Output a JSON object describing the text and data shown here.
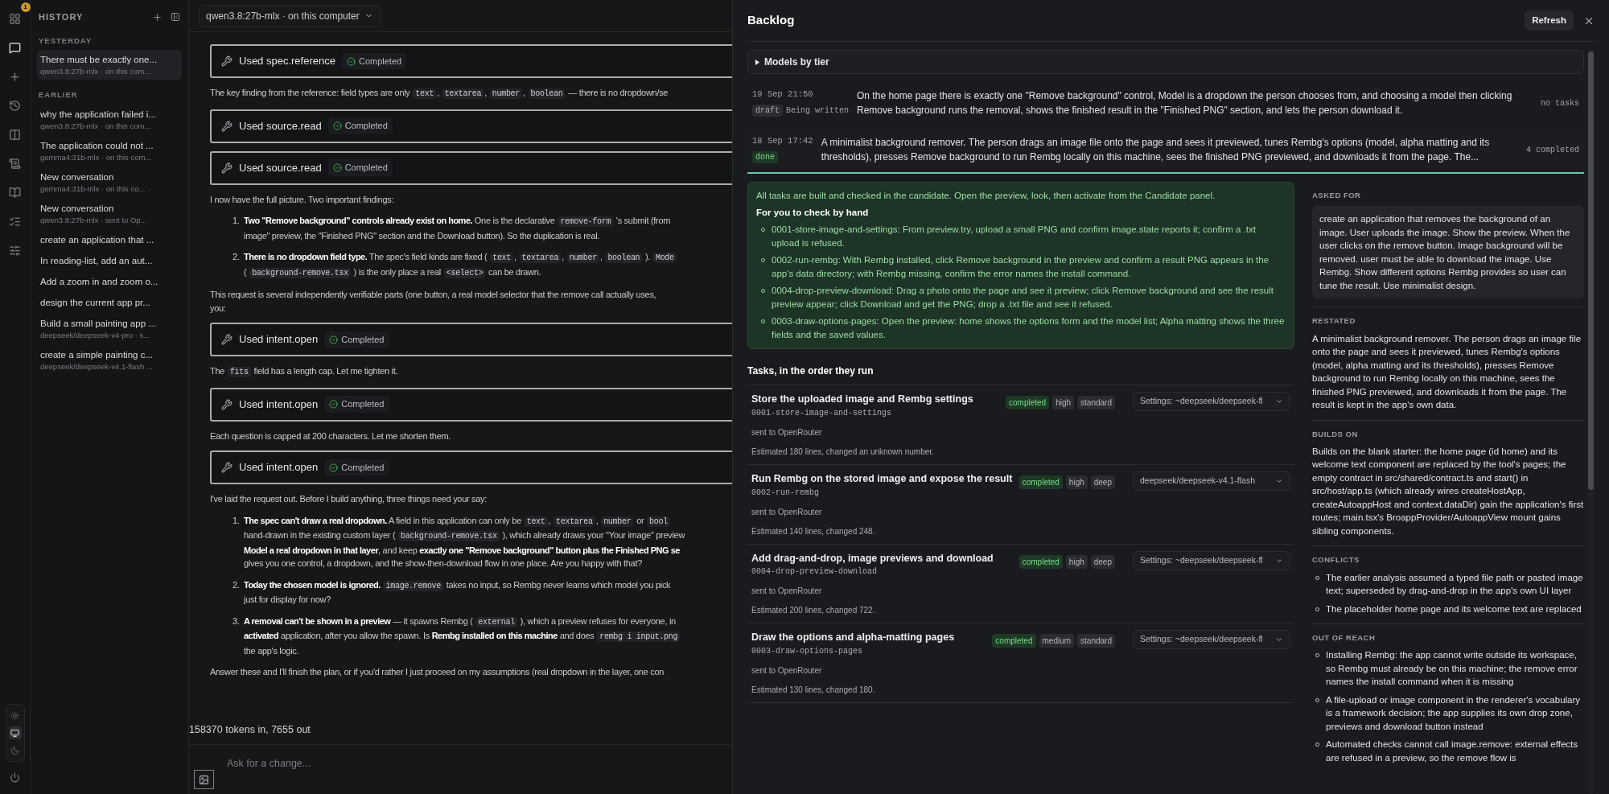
{
  "rail": {
    "items": [
      {
        "kind": "apps",
        "selected": false,
        "badge": "1"
      },
      {
        "kind": "chat",
        "selected": true
      },
      {
        "kind": "new",
        "selected": false
      },
      {
        "kind": "history",
        "selected": false
      },
      {
        "kind": "panel",
        "selected": false
      },
      {
        "kind": "log",
        "selected": false
      },
      {
        "kind": "book",
        "selected": false
      },
      {
        "kind": "tasks",
        "selected": false
      },
      {
        "kind": "settings",
        "selected": false
      }
    ],
    "themes": [
      {
        "kind": "light",
        "selected": false
      },
      {
        "kind": "system",
        "selected": true
      },
      {
        "kind": "dark",
        "selected": false
      }
    ]
  },
  "sidebar": {
    "title": "HISTORY",
    "groups": [
      {
        "label": "YESTERDAY",
        "items": [
          {
            "title": "There must be exactly one...",
            "subtitle": "qwen3.8:27b-mlx · on this com...",
            "selected": true
          }
        ]
      },
      {
        "label": "EARLIER",
        "items": [
          {
            "title": "why the application failed i...",
            "subtitle": "qwen3.8:27b-mlx · on this com...",
            "selected": false
          },
          {
            "title": "The application could not ...",
            "subtitle": "gemma4:31b-mlx · on this com...",
            "selected": false
          },
          {
            "title": "New conversation",
            "subtitle": "gemma4:31b-mlx · on this co...",
            "selected": false
          },
          {
            "title": "New conversation",
            "subtitle": "qwen3.8:27b-mlx · sent to Op...",
            "selected": false
          },
          {
            "title": "create an application that ...",
            "selected": false
          },
          {
            "title": "In reading-list, add an aut...",
            "selected": false
          },
          {
            "title": "Add a zoom in and zoom o...",
            "selected": false
          },
          {
            "title": "design the current app pr...",
            "selected": false
          },
          {
            "title": "Build a small painting app ...",
            "subtitle": "deepseek/deepseek-v4-pro · s...",
            "selected": false
          },
          {
            "title": "create a simple painting c...",
            "subtitle": "deepseek/deepseek-v4.1-flash ...",
            "selected": false
          }
        ]
      }
    ]
  },
  "chat": {
    "model_selector": "qwen3.8:27b-mlx · on this computer",
    "messages": [
      {
        "kind": "tool",
        "name": "Used spec.reference",
        "status": "Completed"
      },
      {
        "kind": "paragraph",
        "lines": [
          [
            {
              "text": "The key finding from the reference: field types are only "
            },
            {
              "code": "text"
            },
            {
              "text": ", "
            },
            {
              "code": "textarea"
            },
            {
              "text": ", "
            },
            {
              "code": "number"
            },
            {
              "text": ", "
            },
            {
              "code": "boolean"
            },
            {
              "text": " — there is no dropdown/se"
            }
          ]
        ]
      },
      {
        "kind": "tool",
        "name": "Used source.read",
        "status": "Completed"
      },
      {
        "kind": "tool",
        "name": "Used source.read",
        "status": "Completed"
      },
      {
        "kind": "paragraph",
        "lines": [
          [
            {
              "text": "I now have the full picture. Two important findings:"
            }
          ]
        ]
      },
      {
        "kind": "list_item",
        "number": "1.",
        "lines": [
          [
            {
              "text": "**Two \"Remove background\" controls already exist on home.** One is the declarative "
            },
            {
              "code": "remove-form"
            },
            {
              "text": " 's submit (from"
            }
          ],
          [
            {
              "text": "image\" preview, the \"Finished PNG\" section and the Download button). So the duplication is real."
            }
          ]
        ]
      },
      {
        "kind": "list_item",
        "number": "2.",
        "lines": [
          [
            {
              "text": "**There is no dropdown field type.** The spec's field kinds are fixed ( "
            },
            {
              "code": "text"
            },
            {
              "text": ", "
            },
            {
              "code": "textarea"
            },
            {
              "text": ", "
            },
            {
              "code": "number"
            },
            {
              "text": ", "
            },
            {
              "code": "boolean"
            },
            {
              "text": " ). "
            },
            {
              "code": "Mode"
            }
          ],
          [
            {
              "text": "( "
            },
            {
              "code": "background-remove.tsx"
            },
            {
              "text": " ) is the only place a real "
            },
            {
              "code": "<select>"
            },
            {
              "text": " can be drawn."
            }
          ]
        ]
      },
      {
        "kind": "paragraph",
        "lines": [
          [
            {
              "text": "This request is several independently verifiable parts (one button, a real model selector that the remove call actually uses,"
            }
          ],
          [
            {
              "text": "you:"
            }
          ]
        ]
      },
      {
        "kind": "tool",
        "name": "Used intent.open",
        "status": "Completed"
      },
      {
        "kind": "paragraph",
        "lines": [
          [
            {
              "text": "The "
            },
            {
              "code": "fits"
            },
            {
              "text": " field has a length cap. Let me tighten it."
            }
          ]
        ]
      },
      {
        "kind": "tool",
        "name": "Used intent.open",
        "status": "Completed"
      },
      {
        "kind": "paragraph",
        "lines": [
          [
            {
              "text": "Each question is capped at 200 characters. Let me shorten them."
            }
          ]
        ]
      },
      {
        "kind": "tool",
        "name": "Used intent.open",
        "status": "Completed"
      },
      {
        "kind": "paragraph",
        "lines": [
          [
            {
              "text": "I've laid the request out. Before I build anything, three things need your say:"
            }
          ]
        ]
      },
      {
        "kind": "list_item",
        "number": "1.",
        "lines": [
          [
            {
              "text": "**The spec can't draw a real dropdown.** A field in this application can only be "
            },
            {
              "code": "text"
            },
            {
              "text": ", "
            },
            {
              "code": "textarea"
            },
            {
              "text": ", "
            },
            {
              "code": "number"
            },
            {
              "text": " or "
            },
            {
              "code": "bool"
            }
          ],
          [
            {
              "text": "hand-drawn in the existing custom layer ( "
            },
            {
              "code": "background-remove.tsx"
            },
            {
              "text": " ), which already draws your \"Your image\" preview"
            }
          ],
          [
            {
              "text": "**Model a real dropdown in that layer**, and keep **exactly one \"Remove background\" button plus the Finished PNG se**"
            }
          ],
          [
            {
              "text": "gives you one control, a dropdown, and the show-then-download flow in one place. Are you happy with that?"
            }
          ]
        ]
      },
      {
        "kind": "list_item",
        "number": "2.",
        "lines": [
          [
            {
              "text": "**Today the chosen model is ignored.** "
            },
            {
              "code": "image.remove"
            },
            {
              "text": " takes no input, so Rembg never learns which model you pick"
            }
          ],
          [
            {
              "text": "just for display for now?"
            }
          ]
        ]
      },
      {
        "kind": "list_item",
        "number": "3.",
        "lines": [
          [
            {
              "text": "**A removal can't be shown in a preview** — it spawns Rembg ( "
            },
            {
              "code": "external"
            },
            {
              "text": " ), which a preview refuses for everyone, in"
            }
          ],
          [
            {
              "text": "**activated** application, after you allow the spawn. Is **Rembg installed on this machine** and does "
            },
            {
              "code": "rembg i input.png"
            }
          ],
          [
            {
              "text": "the app's logic."
            }
          ]
        ]
      },
      {
        "kind": "paragraph",
        "lines": [
          [
            {
              "text": "Answer these and I'll finish the plan, or if you'd rather I just proceed on my assumptions (real dropdown in the layer, one con"
            }
          ]
        ]
      }
    ],
    "usage": "158370 tokens in, 7655 out",
    "composer": {
      "placeholder": "Ask for a change..."
    }
  },
  "backlog": {
    "title": "Backlog",
    "refresh": "Refresh",
    "models_by_tier": {
      "label": "Models by tier",
      "expanded": false
    },
    "specs": [
      {
        "time": "19 Sep 21:50",
        "status": {
          "label": "draft",
          "kind": "neutral"
        },
        "note": "Being written",
        "summary": "On the home page there is exactly one \"Remove background\" control, Model is a dropdown the person chooses from, and choosing a model then clicking Remove background runs the removal, shows the finished result in the \"Finished PNG\" section, and lets the person download it.",
        "count": "no tasks",
        "selected": false
      },
      {
        "time": "18 Sep 17:42",
        "status": {
          "label": "done",
          "kind": "success"
        },
        "summary": "A minimalist background remover. The person drags an image file onto the page and sees it previewed, tunes Rembg's options (model, alpha matting and its thresholds), presses Remove background to run Rembg locally on this machine, sees the finished PNG previewed, and downloads it from the page. The...",
        "count": "4 completed",
        "selected": true
      }
    ],
    "check": {
      "intro": "All tasks are built and checked in the candidate. Open the preview, look, then activate from the Candidate panel.",
      "heading": "For you to check by hand",
      "items": [
        "0001-store-image-and-settings: From preview.try, upload a small PNG and confirm image.state reports it; confirm a .txt upload is refused.",
        "0002-run-rembg: With Rembg installed, click Remove background in the preview and confirm a result PNG appears in the app's data directory; with Rembg missing, confirm the error names the install command.",
        "0004-drop-preview-download: Drag a photo onto the page and see it preview; click Remove background and see the result preview appear; click Download and get the PNG; drop a .txt file and see it refused.",
        "0003-draw-options-pages: Open the preview: home shows the options form and the model list; Alpha matting shows the three fields and the saved values."
      ]
    },
    "tasks_heading": "Tasks, in the order they run",
    "tasks": [
      {
        "title": "Store the uploaded image and Rembg settings",
        "id": "0001-store-image-and-settings",
        "route": "sent to OpenRouter",
        "estimate": "Estimated 180 lines, changed an unknown number.",
        "tags": [
          {
            "text": "completed",
            "kind": "status"
          },
          {
            "text": "high",
            "kind": "plain"
          },
          {
            "text": "standard",
            "kind": "plain"
          }
        ],
        "model": "Settings: ~deepseek/deepseek-fl"
      },
      {
        "title": "Run Rembg on the stored image and expose the result",
        "id": "0002-run-rembg",
        "route": "sent to OpenRouter",
        "estimate": "Estimated 140 lines, changed 248.",
        "tags": [
          {
            "text": "completed",
            "kind": "status"
          },
          {
            "text": "high",
            "kind": "plain"
          },
          {
            "text": "deep",
            "kind": "plain"
          }
        ],
        "model": "deepseek/deepseek-v4.1-flash"
      },
      {
        "title": "Add drag-and-drop, image previews and download",
        "id": "0004-drop-preview-download",
        "route": "sent to OpenRouter",
        "estimate": "Estimated 200 lines, changed 722.",
        "tags": [
          {
            "text": "completed",
            "kind": "status"
          },
          {
            "text": "high",
            "kind": "plain"
          },
          {
            "text": "deep",
            "kind": "plain"
          }
        ],
        "model": "Settings: ~deepseek/deepseek-fl"
      },
      {
        "title": "Draw the options and alpha-matting pages",
        "id": "0003-draw-options-pages",
        "route": "sent to OpenRouter",
        "estimate": "Estimated 130 lines, changed 180.",
        "tags": [
          {
            "text": "completed",
            "kind": "status"
          },
          {
            "text": "medium",
            "kind": "plain"
          },
          {
            "text": "standard",
            "kind": "plain"
          }
        ],
        "model": "Settings: ~deepseek/deepseek-fl"
      }
    ],
    "sections": [
      {
        "heading": "ASKED FOR",
        "kind": "quote",
        "text": "create an application that removes the background of an image. User uploads the image. Show the preview. When the user clicks on the remove button. Image background will be removed. user must be able to download the image. Use Rembg. Show different options Rembg provides so user can tune the result. Use minimalist design."
      },
      {
        "heading": "RESTATED",
        "kind": "text",
        "text": "A minimalist background remover. The person drags an image file onto the page and sees it previewed, tunes Rembg's options (model, alpha matting and its thresholds), presses Remove background to run Rembg locally on this machine, sees the finished PNG previewed, and downloads it from the page. The result is kept in the app's own data."
      },
      {
        "heading": "BUILDS ON",
        "kind": "text",
        "text": "Builds on the blank starter: the home page (id home) and its welcome text component are replaced by the tool's pages; the empty contract in src/shared/contract.ts and start() in src/host/app.ts (which already wires createHostApp, createAutoappHost and context.dataDir) gain the application's first routes; main.tsx's BroappProvider/AutoappView mount gains sibling components."
      },
      {
        "heading": "CONFLICTS",
        "kind": "list",
        "items": [
          "The earlier analysis assumed a typed file path or pasted image text; superseded by drag-and-drop in the app's own UI layer",
          "The placeholder home page and its welcome text are replaced"
        ]
      },
      {
        "heading": "OUT OF REACH",
        "kind": "list",
        "items": [
          "Installing Rembg: the app cannot write outside its workspace, so Rembg must already be on this machine; the remove error names the install command when it is missing",
          "A file-upload or image component in the renderer's vocabulary is a framework decision; the app supplies its own drop zone, previews and download button instead",
          "Automated checks cannot call image.remove: external effects are refused in a preview, so the remove flow is"
        ]
      }
    ]
  }
}
